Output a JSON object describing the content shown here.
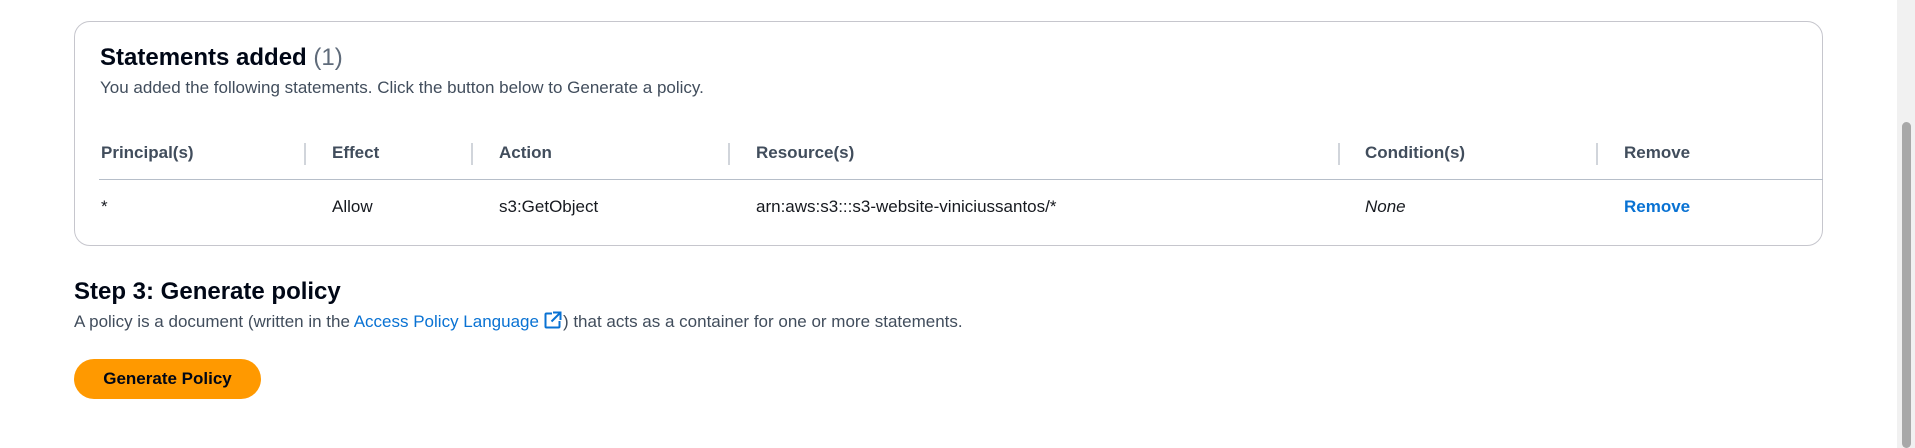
{
  "statements": {
    "title": "Statements added",
    "count": "(1)",
    "description": "You added the following statements. Click the button below to Generate a policy.",
    "columns": [
      "Principal(s)",
      "Effect",
      "Action",
      "Resource(s)",
      "Condition(s)",
      "Remove"
    ],
    "rows": [
      {
        "principal": "*",
        "effect": "Allow",
        "action": "s3:GetObject",
        "resource": "arn:aws:s3:::s3-website-viniciussantos/*",
        "condition": "None",
        "remove": "Remove"
      }
    ]
  },
  "step3": {
    "title": "Step 3: Generate policy",
    "desc_before": "A policy is a document (written in the ",
    "link_text": "Access Policy Language",
    "desc_after": ") that acts as a container for one or more statements.",
    "button_label": "Generate Policy"
  },
  "colors": {
    "primary_button": "#ff9900",
    "link": "#0972d3"
  },
  "icons": {
    "external_link": "external-link-icon"
  }
}
